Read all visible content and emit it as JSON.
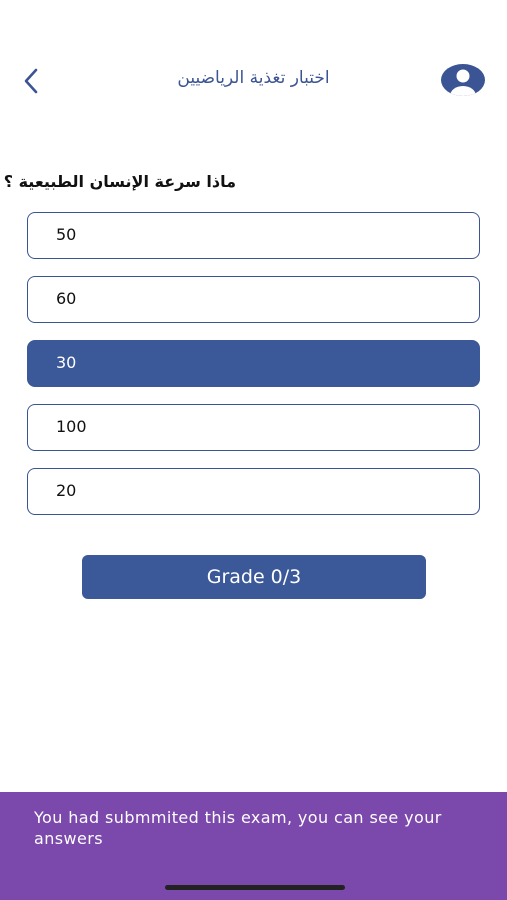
{
  "header": {
    "title": "اختبار تغذية الرياضيين",
    "back_icon": "chevron-left-icon",
    "avatar_icon": "user-avatar-icon"
  },
  "quiz": {
    "question": "ماذا سرعة الإنسان الطبيعية ؟",
    "options": [
      {
        "label": "50",
        "selected": false
      },
      {
        "label": "60",
        "selected": false
      },
      {
        "label": "30",
        "selected": true
      },
      {
        "label": "100",
        "selected": false
      },
      {
        "label": "20",
        "selected": false
      }
    ],
    "grade_label": "Grade 0/3"
  },
  "banner": {
    "message": "You had submmited this exam, you can see your answers"
  },
  "colors": {
    "accent": "#3b5898",
    "banner": "#7b48ab",
    "title": "#3b5493"
  }
}
